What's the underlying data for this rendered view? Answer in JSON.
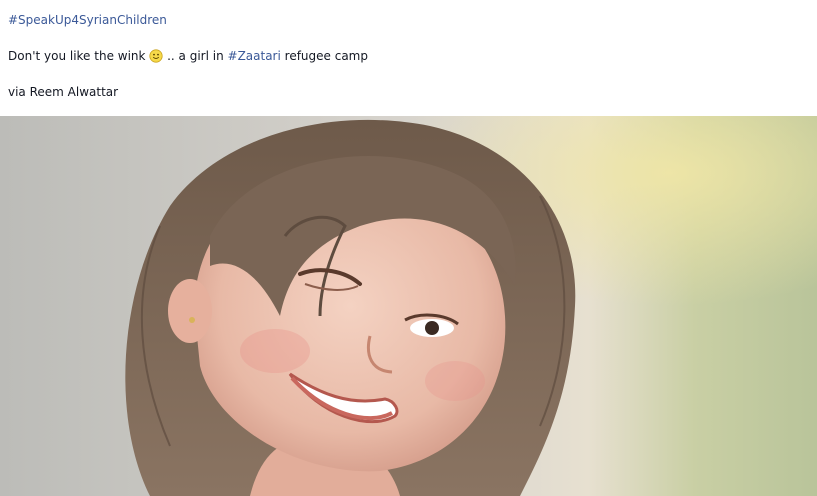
{
  "post": {
    "hashtag_top": "#SpeakUp4SyrianChildren",
    "line2_before": "Don't you like the wink",
    "line2_middle": " .. a girl in ",
    "line2_hashtag": "#Zaatari",
    "line2_after": " refugee camp",
    "credit": "via Reem Alwattar",
    "emoji": "smiley-icon"
  },
  "photo": {
    "subject": "winking-girl-photo"
  },
  "colors": {
    "link": "#3b5998",
    "text": "#141823"
  }
}
